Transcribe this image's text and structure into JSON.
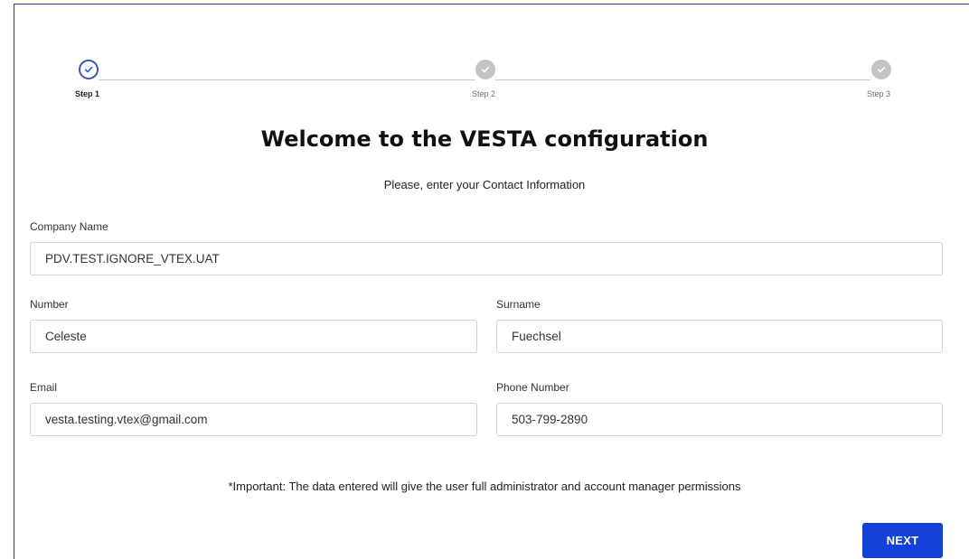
{
  "stepper": {
    "steps": [
      {
        "label": "Step 1",
        "state": "active",
        "icon": "check-icon"
      },
      {
        "label": "Step 2",
        "state": "inactive",
        "icon": "check-icon"
      },
      {
        "label": "Step 3",
        "state": "inactive",
        "icon": "check-icon"
      }
    ]
  },
  "header": {
    "title": "Welcome to the VESTA configuration",
    "subtitle": "Please, enter your Contact Information"
  },
  "form": {
    "company_name": {
      "label": "Company Name",
      "value": "PDV.TEST.IGNORE_VTEX.UAT"
    },
    "number": {
      "label": "Number",
      "value": "Celeste"
    },
    "surname": {
      "label": "Surname",
      "value": "Fuechsel"
    },
    "email": {
      "label": "Email",
      "value": "vesta.testing.vtex@gmail.com"
    },
    "phone": {
      "label": "Phone Number",
      "value": "503-799-2890"
    }
  },
  "notice": "*Important: The data entered will give the user full administrator and account manager permissions",
  "actions": {
    "next_label": "NEXT"
  },
  "colors": {
    "accent": "#1442d9",
    "active_step": "#3b55c7",
    "inactive_step": "#c4c4c4",
    "frame_border": "#2b3a8c"
  }
}
